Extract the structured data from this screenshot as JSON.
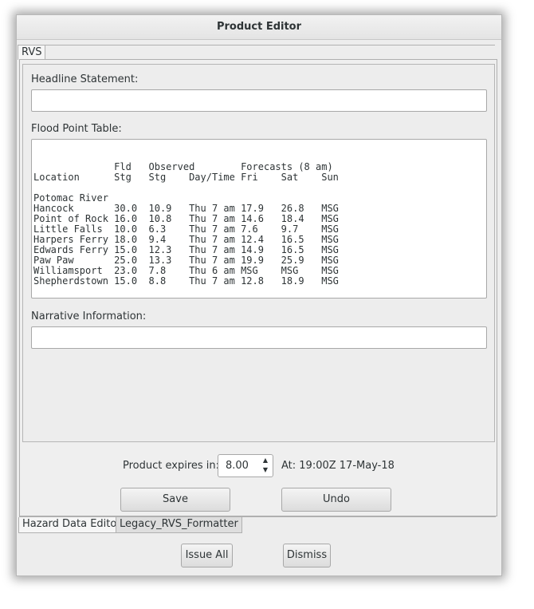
{
  "window": {
    "title": "Product Editor"
  },
  "top_tab": {
    "label": "RVS"
  },
  "headline": {
    "label": "Headline Statement:",
    "value": ""
  },
  "flood_table": {
    "label": "Flood Point Table:",
    "lines": [
      "              Fld   Observed        Forecasts (8 am)",
      "Location      Stg   Stg    Day/Time Fri    Sat    Sun",
      "",
      "Potomac River",
      "Hancock       30.0  10.9   Thu 7 am 17.9   26.8   MSG",
      "Point of Rock 16.0  10.8   Thu 7 am 14.6   18.4   MSG",
      "Little Falls  10.0  6.3    Thu 7 am 7.6    9.7    MSG",
      "Harpers Ferry 18.0  9.4    Thu 7 am 12.4   16.5   MSG",
      "Edwards Ferry 15.0  12.3   Thu 7 am 14.9   16.5   MSG",
      "Paw Paw       25.0  13.3   Thu 7 am 19.9   25.9   MSG",
      "Williamsport  23.0  7.8    Thu 6 am MSG    MSG    MSG",
      "Shepherdstown 15.0  8.8    Thu 7 am 12.8   18.9   MSG"
    ]
  },
  "narrative": {
    "label": "Narrative Information:",
    "value": ""
  },
  "expires": {
    "label": "Product expires in:",
    "value": "8.00",
    "at_text": "At: 19:00Z 17-May-18"
  },
  "buttons": {
    "save": "Save",
    "undo": "Undo",
    "issue_all": "Issue All",
    "dismiss": "Dismiss"
  },
  "bottom_tabs": [
    {
      "label": "Hazard Data Editor"
    },
    {
      "label": "Legacy_RVS_Formatter"
    }
  ],
  "icons": {
    "spin_up": "triangle-up",
    "spin_down": "triangle-down"
  }
}
